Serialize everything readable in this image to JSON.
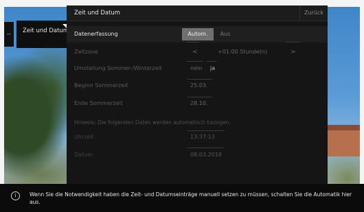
{
  "nav": {
    "dash": "--",
    "item_label": "Zeit und Datum"
  },
  "header": {
    "title": "Zeit und Datum",
    "back_label": "Zurück"
  },
  "rows": {
    "erfassung": {
      "label": "Datenerfassung",
      "on": "Autom.",
      "off": "Aus"
    },
    "zeitzone": {
      "label": "Zeitzone",
      "prev": "<",
      "value": "+01:00 Stunde(n)",
      "next": ">"
    },
    "sommer": {
      "label": "Umstellung Sommer-/Winterzeit",
      "no": "nein",
      "yes": "ja"
    },
    "beginn": {
      "label": "Beginn Sommerzeit",
      "value": "25.03."
    },
    "ende": {
      "label": "Ende Sommerzeit",
      "value": "28.10."
    },
    "hinweis": "Hinweis: Die folgenden Daten werden automatisch bezogen.",
    "uhrzeit": {
      "label": "Uhrzeit",
      "value": "13:37:13"
    },
    "datum": {
      "label": "Datum",
      "value": "08.03.2018"
    }
  },
  "bottom": {
    "icon": "info-icon",
    "text": "Wenn Sie die Notwendigkeit haben die Zeit- und Datumseinträge manuell setzen zu müssen, schalten Sie die Automatik hier aus."
  }
}
